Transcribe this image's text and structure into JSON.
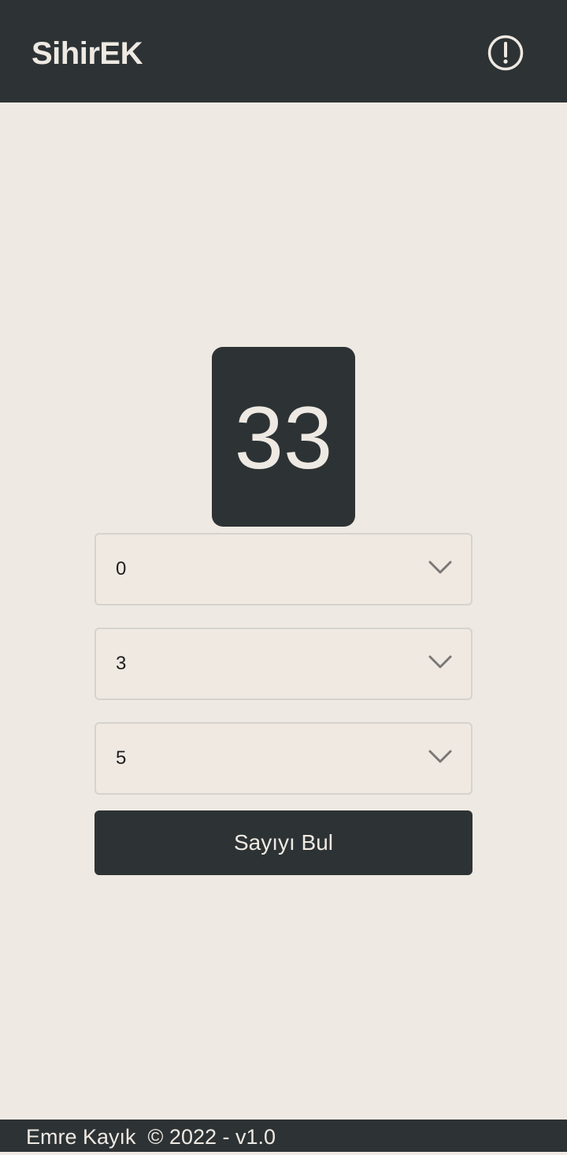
{
  "app_bar": {
    "title": "SihirEK",
    "info_icon": "exclamation-circle-icon"
  },
  "result": {
    "number": "33"
  },
  "selects": [
    {
      "value": "0",
      "icon": "chevron-down-icon"
    },
    {
      "value": "3",
      "icon": "chevron-down-icon"
    },
    {
      "value": "5",
      "icon": "chevron-down-icon"
    }
  ],
  "action": {
    "label": "Sayıyı Bul"
  },
  "footer": {
    "text": "Emre Kayık  © 2022 - v1.0"
  },
  "colors": {
    "dark": "#2d3335",
    "background": "#eee9e2",
    "border": "#d6d3ce",
    "chevron": "#7a7775"
  }
}
